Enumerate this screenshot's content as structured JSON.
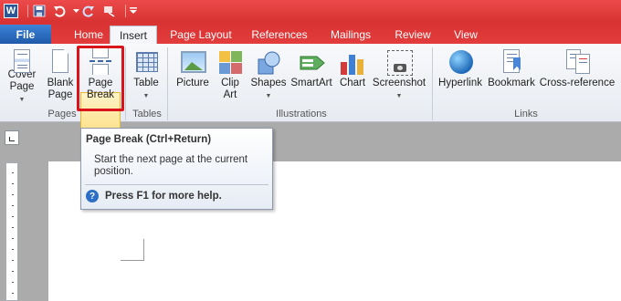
{
  "quick_access": {
    "icons": [
      "word-logo-icon",
      "save-icon",
      "undo-icon",
      "redo-icon",
      "customize-icon"
    ]
  },
  "tabs": [
    {
      "label": "File"
    },
    {
      "label": "Home"
    },
    {
      "label": "Insert"
    },
    {
      "label": "Page Layout"
    },
    {
      "label": "References"
    },
    {
      "label": "Mailings"
    },
    {
      "label": "Review"
    },
    {
      "label": "View"
    }
  ],
  "ribbon": {
    "pages": {
      "group_label": "Pages",
      "cover_page": "Cover Page",
      "cover_page_l1": "Cover",
      "cover_page_l2": "Page",
      "blank_page_l1": "Blank",
      "blank_page_l2": "Page",
      "page_break_l1": "Page",
      "page_break_l2": "Break"
    },
    "tables": {
      "group_label": "Tables",
      "table": "Table"
    },
    "illustrations": {
      "group_label": "Illustrations",
      "picture": "Picture",
      "clip_art_l1": "Clip",
      "clip_art_l2": "Art",
      "shapes": "Shapes",
      "smartart": "SmartArt",
      "chart": "Chart",
      "screenshot": "Screenshot"
    },
    "links": {
      "group_label": "Links",
      "hyperlink": "Hyperlink",
      "bookmark": "Bookmark",
      "cross_reference": "Cross-reference"
    }
  },
  "tooltip": {
    "title": "Page Break (Ctrl+Return)",
    "description": "Start the next page at the current position.",
    "help": "Press F1 for more help."
  },
  "colors": {
    "title_bar": "#e03a3a",
    "file_tab": "#2a6bbf",
    "highlight": "#d9141a"
  }
}
